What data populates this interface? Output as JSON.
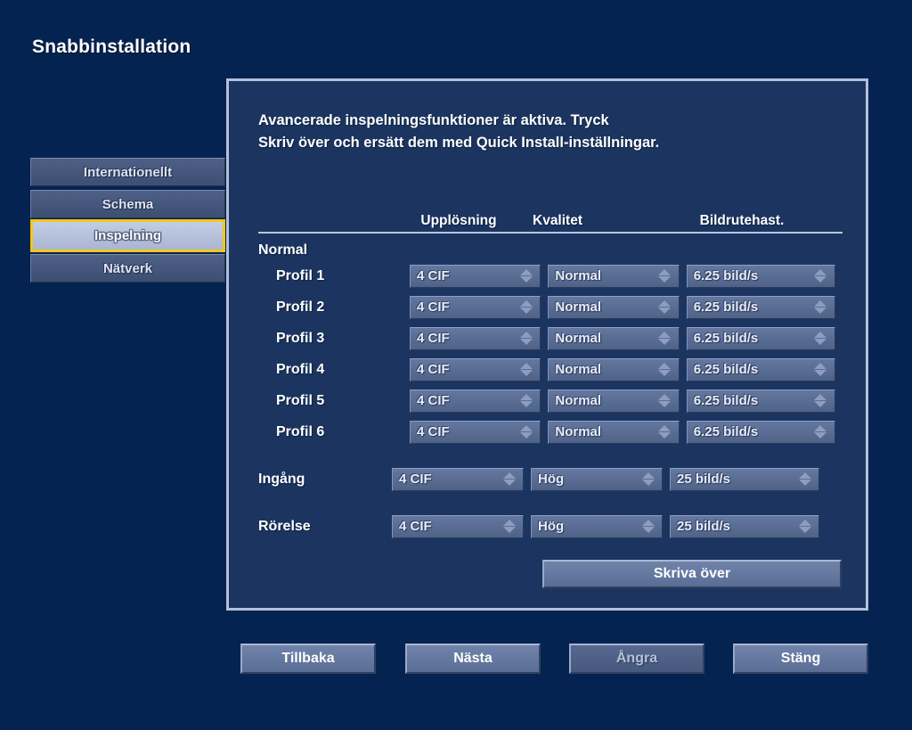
{
  "title": "Snabbinstallation",
  "sidebar": {
    "items": [
      {
        "label": "Internationellt",
        "selected": false
      },
      {
        "label": "Schema",
        "selected": false
      },
      {
        "label": "Inspelning",
        "selected": true
      },
      {
        "label": "Nätverk",
        "selected": false
      }
    ]
  },
  "panel": {
    "message": "Avancerade inspelningsfunktioner är aktiva. Tryck\nSkriv över och ersätt dem med Quick Install-inställningar.",
    "table": {
      "headers": {
        "label": "",
        "resolution": "Upplösning",
        "quality": "Kvalitet",
        "framerate": "Bildrutehast."
      },
      "group_title": "Normal",
      "rows": [
        {
          "label": "Profil 1",
          "resolution": "4 CIF",
          "quality": "Normal",
          "framerate": "6.25 bild/s"
        },
        {
          "label": "Profil 2",
          "resolution": "4 CIF",
          "quality": "Normal",
          "framerate": "6.25 bild/s"
        },
        {
          "label": "Profil 3",
          "resolution": "4 CIF",
          "quality": "Normal",
          "framerate": "6.25 bild/s"
        },
        {
          "label": "Profil 4",
          "resolution": "4 CIF",
          "quality": "Normal",
          "framerate": "6.25 bild/s"
        },
        {
          "label": "Profil 5",
          "resolution": "4 CIF",
          "quality": "Normal",
          "framerate": "6.25 bild/s"
        },
        {
          "label": "Profil 6",
          "resolution": "4 CIF",
          "quality": "Normal",
          "framerate": "6.25 bild/s"
        }
      ],
      "extra_rows": [
        {
          "label": "Ingång",
          "resolution": "4 CIF",
          "quality": "Hög",
          "framerate": "25 bild/s"
        },
        {
          "label": "Rörelse",
          "resolution": "4 CIF",
          "quality": "Hög",
          "framerate": "25 bild/s"
        }
      ]
    },
    "overwrite_button": "Skriva över"
  },
  "footer": {
    "back": "Tillbaka",
    "next": "Nästa",
    "undo": "Ångra",
    "close": "Stäng"
  },
  "colors": {
    "background": "#042350",
    "panel_bg": "#1b3560",
    "panel_border": "#b3c0d9",
    "nav_bg": "#4e6086",
    "nav_selected_bg": "#b8c4dd",
    "nav_selected_border": "#f5c518",
    "control_bg": "#5f729a",
    "text": "#ffffff"
  }
}
